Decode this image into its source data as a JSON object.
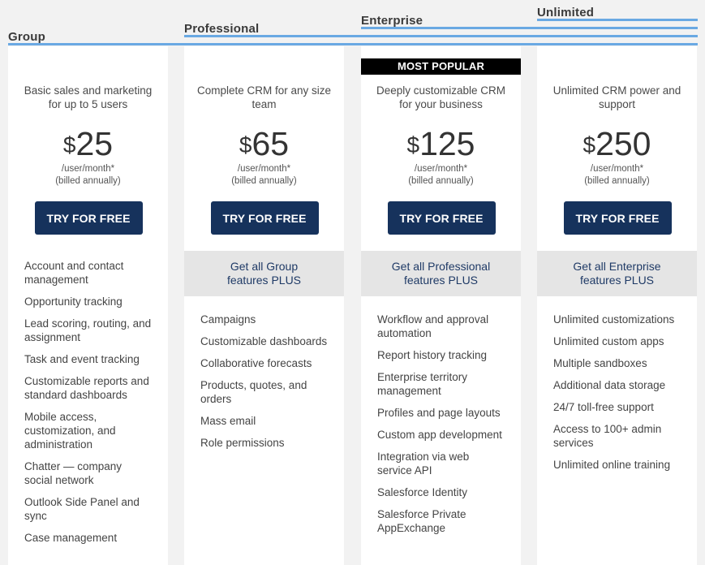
{
  "badge": "MOST POPULAR",
  "cta_label": "TRY FOR FREE",
  "plans": [
    {
      "name": "Group",
      "description": "Basic sales and marketing for up to 5 users",
      "currency": "$",
      "price": "25",
      "unit_line1": "/user/month*",
      "unit_line2": "(billed annually)",
      "plus_line1": "",
      "plus_line2": "",
      "features": [
        "Account and contact management",
        "Opportunity tracking",
        "Lead scoring, routing, and assignment",
        "Task and event tracking",
        "Customizable reports and standard dashboards",
        "Mobile access, customization, and administration",
        "Chatter — company social network",
        "Outlook Side Panel and sync",
        "Case management"
      ]
    },
    {
      "name": "Professional",
      "description": "Complete CRM for any size team",
      "currency": "$",
      "price": "65",
      "unit_line1": "/user/month*",
      "unit_line2": "(billed annually)",
      "plus_line1": "Get all Group",
      "plus_line2": "features PLUS",
      "features": [
        "Campaigns",
        "Customizable dashboards",
        "Collaborative forecasts",
        "Products, quotes, and orders",
        "Mass email",
        "Role permissions"
      ]
    },
    {
      "name": "Enterprise",
      "description": "Deeply customizable CRM for your business",
      "currency": "$",
      "price": "125",
      "unit_line1": "/user/month*",
      "unit_line2": "(billed annually)",
      "plus_line1": "Get all Professional",
      "plus_line2": "features PLUS",
      "features": [
        "Workflow and approval automation",
        "Report history tracking",
        "Enterprise territory management",
        "Profiles and page layouts",
        "Custom app development",
        "Integration via web service API",
        "Salesforce Identity",
        "Salesforce Private AppExchange"
      ]
    },
    {
      "name": "Unlimited",
      "description": "Unlimited CRM power and support",
      "currency": "$",
      "price": "250",
      "unit_line1": "/user/month*",
      "unit_line2": "(billed annually)",
      "plus_line1": "Get all Enterprise",
      "plus_line2": "features PLUS",
      "features": [
        "Unlimited customizations",
        "Unlimited custom apps",
        "Multiple sandboxes",
        "Additional data storage",
        "24/7 toll-free support",
        "Access to 100+ admin services",
        "Unlimited online training"
      ]
    }
  ],
  "colors": {
    "accent_line": "#6aa9e3",
    "cta_background": "#16325c",
    "plus_background": "#e5e5e5",
    "plus_text": "#1f3a66",
    "page_background": "#f2f2f2"
  }
}
